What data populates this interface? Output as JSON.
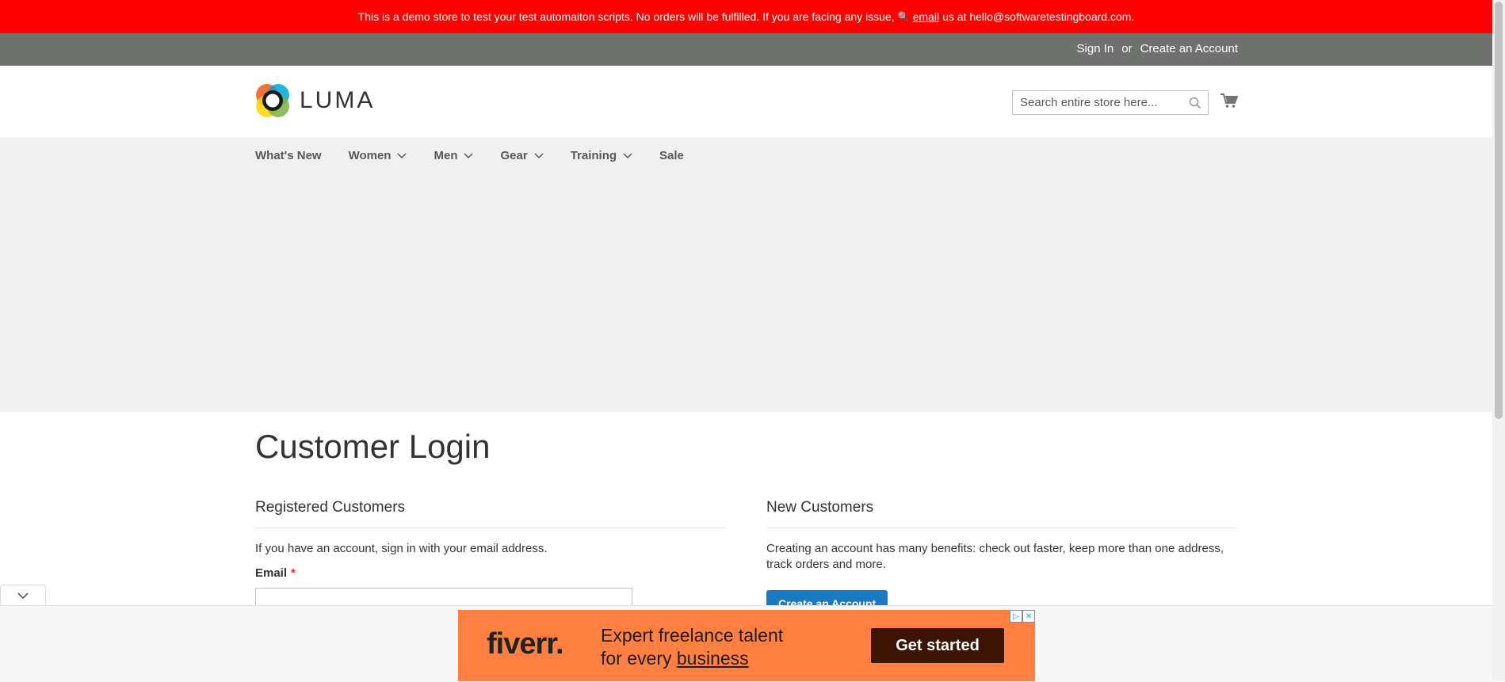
{
  "demo_banner": {
    "text_before": "This is a demo store to test your test automaiton scripts. No orders will be fulfilled. If you are facing any issue,",
    "link_text": "email",
    "text_after": "us at hello@softwaretestingboard.com."
  },
  "top_links": {
    "sign_in": "Sign In",
    "or": "or",
    "create_account": "Create an Account"
  },
  "header": {
    "logo_text": "LUMA",
    "search_placeholder": "Search entire store here..."
  },
  "nav": {
    "items": [
      {
        "label": "What's New",
        "has_dropdown": false
      },
      {
        "label": "Women",
        "has_dropdown": true
      },
      {
        "label": "Men",
        "has_dropdown": true
      },
      {
        "label": "Gear",
        "has_dropdown": true
      },
      {
        "label": "Training",
        "has_dropdown": true
      },
      {
        "label": "Sale",
        "has_dropdown": false
      }
    ]
  },
  "main": {
    "page_title": "Customer Login",
    "registered": {
      "title": "Registered Customers",
      "description": "If you have an account, sign in with your email address.",
      "email_label": "Email",
      "required_mark": "*"
    },
    "new_customers": {
      "title": "New Customers",
      "description": "Creating an account has many benefits: check out faster, keep more than one address, track orders and more.",
      "create_button": "Create an Account"
    }
  },
  "ad": {
    "logo": "fiverr.",
    "line1": "Expert freelance talent",
    "line2_prefix": "for every",
    "line2_link": "business",
    "cta": "Get started"
  },
  "colors": {
    "banner": "#ff0000",
    "top_bar": "#6e716e",
    "nav_bg": "#f0f0f0",
    "primary_button": "#1979c3",
    "ad_bg": "#ff8041",
    "ad_cta": "#3b1502"
  },
  "icons": {
    "banner": "key-icon",
    "search": "search-icon",
    "cart": "cart-icon",
    "dropdown": "chevron-down-icon",
    "ad_toggle": "chevron-down-icon"
  }
}
